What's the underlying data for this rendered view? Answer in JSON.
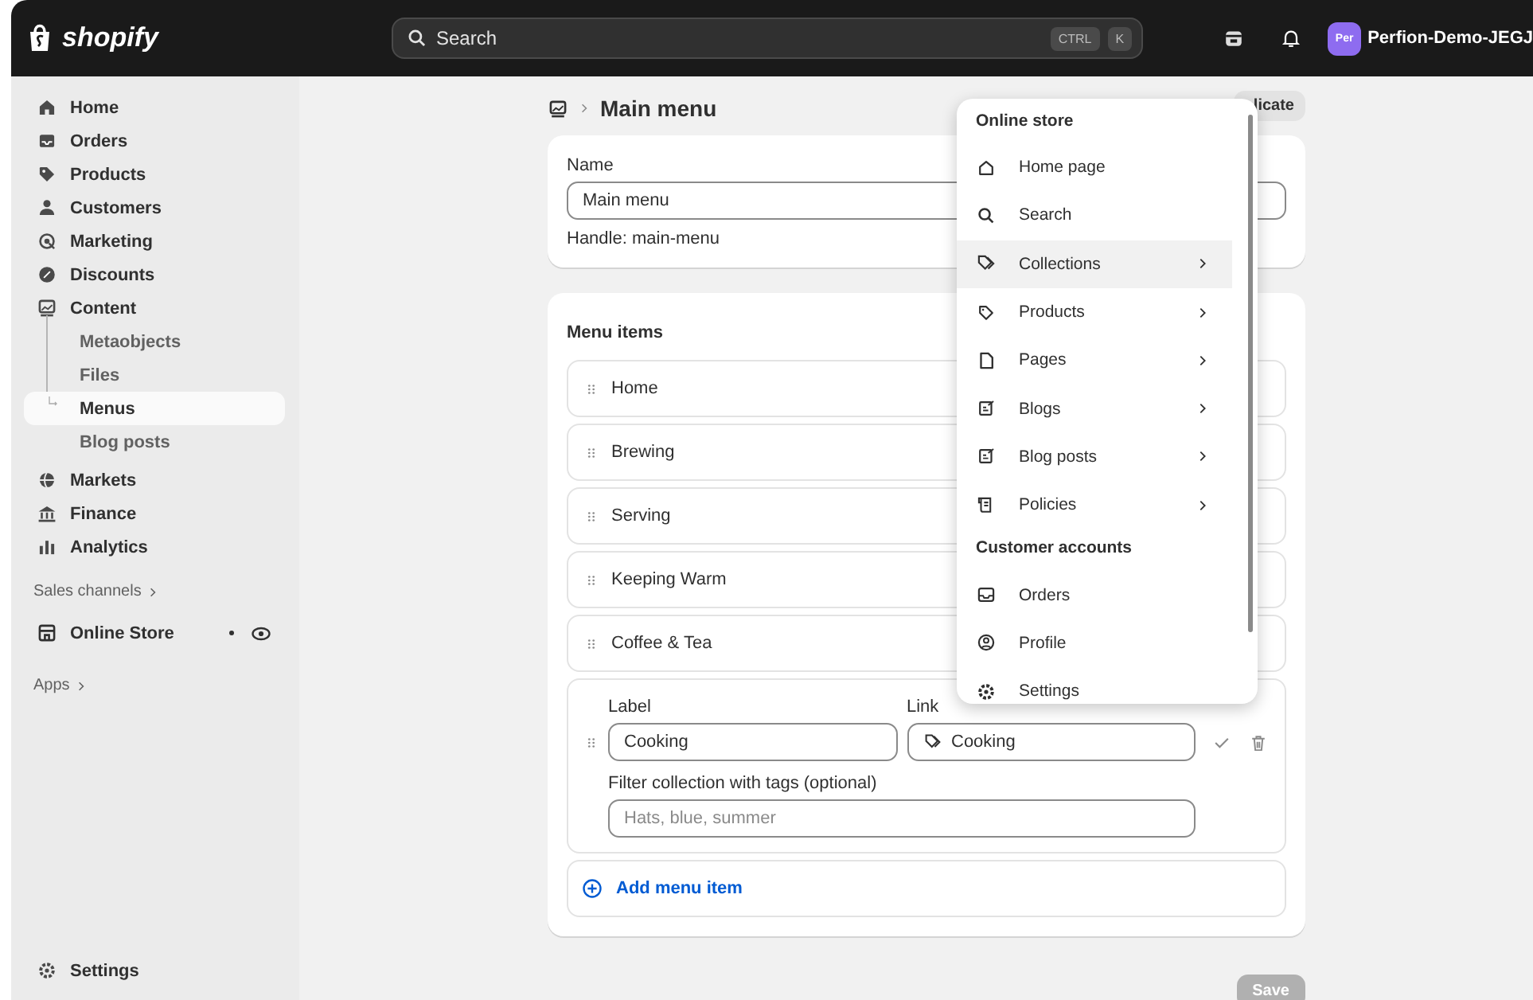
{
  "topbar": {
    "logo": "shopify",
    "search": {
      "placeholder": "Search"
    },
    "shortcut": [
      "CTRL",
      "K"
    ],
    "avatar": "Per",
    "store_name": "Perfion-Demo-JEGJ"
  },
  "sidebar": {
    "items": [
      {
        "label": "Home",
        "selected": false
      },
      {
        "label": "Orders",
        "selected": false
      },
      {
        "label": "Products",
        "selected": false
      },
      {
        "label": "Customers",
        "selected": false
      },
      {
        "label": "Marketing",
        "selected": false
      },
      {
        "label": "Discounts",
        "selected": false
      },
      {
        "label": "Content",
        "selected": false,
        "children": [
          {
            "label": "Metaobjects",
            "selected": false
          },
          {
            "label": "Files",
            "selected": false
          },
          {
            "label": "Menus",
            "selected": true
          },
          {
            "label": "Blog posts",
            "selected": false
          }
        ]
      },
      {
        "label": "Markets",
        "selected": false
      },
      {
        "label": "Finance",
        "selected": false
      },
      {
        "label": "Analytics",
        "selected": false
      }
    ],
    "sales_channels": "Sales channels",
    "channels": [
      {
        "label": "Online Store"
      }
    ],
    "apps": "Apps",
    "settings": "Settings"
  },
  "page": {
    "title": "Main menu",
    "duplicate_button": "licate",
    "name_card": {
      "label": "Name",
      "value": "Main menu",
      "handle": "Handle: main-menu"
    },
    "menu_items_card": {
      "title": "Menu items",
      "items": [
        "Home",
        "Brewing",
        "Serving",
        "Keeping Warm",
        "Coffee & Tea"
      ],
      "editing": {
        "label_label": "Label",
        "label_value": "Cooking",
        "link_label": "Link",
        "link_value": "Cooking",
        "filter_label": "Filter collection with tags (optional)",
        "filter_placeholder": "Hats, blue, summer"
      },
      "add_button": "Add menu item"
    },
    "save_button": {
      "label": "Save",
      "disabled": true
    }
  },
  "link_dropdown": {
    "sections": [
      {
        "title": "Online store",
        "items": [
          {
            "label": "Home page",
            "has_submenu": false,
            "selected": false
          },
          {
            "label": "Search",
            "has_submenu": false,
            "selected": false
          },
          {
            "label": "Collections",
            "has_submenu": true,
            "selected": true
          },
          {
            "label": "Products",
            "has_submenu": true,
            "selected": false
          },
          {
            "label": "Pages",
            "has_submenu": true,
            "selected": false
          },
          {
            "label": "Blogs",
            "has_submenu": true,
            "selected": false
          },
          {
            "label": "Blog posts",
            "has_submenu": true,
            "selected": false
          },
          {
            "label": "Policies",
            "has_submenu": true,
            "selected": false
          }
        ]
      },
      {
        "title": "Customer accounts",
        "items": [
          {
            "label": "Orders",
            "has_submenu": false,
            "selected": false
          },
          {
            "label": "Profile",
            "has_submenu": false,
            "selected": false
          },
          {
            "label": "Settings",
            "has_submenu": false,
            "selected": false
          }
        ]
      }
    ]
  }
}
